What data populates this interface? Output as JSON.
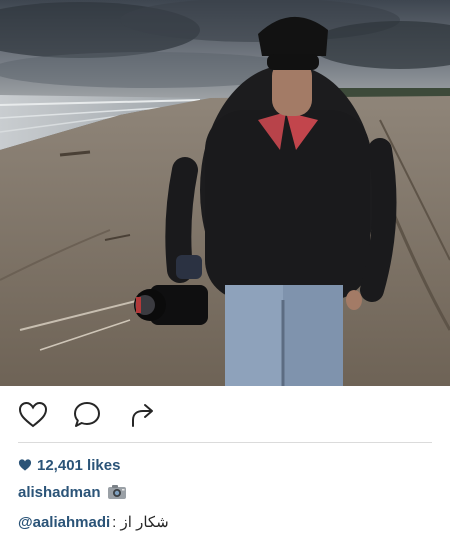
{
  "post": {
    "photo": {
      "alt": "Man in black jacket holding a camera on a beach",
      "sky_color": "#5e6670",
      "sand_color": "#8a7d6e"
    },
    "actions": {
      "like_icon": "heart-outline-icon",
      "comment_icon": "speech-bubble-icon",
      "share_icon": "share-arrow-icon"
    },
    "likes": {
      "count_text": "12,401 likes",
      "icon": "heart-filled-icon",
      "color": "#2b5478"
    },
    "author": {
      "username": "alishadman",
      "emoji_icon": "camera-emoji-icon"
    },
    "caption": {
      "mention": "@aaliahmadi",
      "text": "شکار از :"
    }
  }
}
